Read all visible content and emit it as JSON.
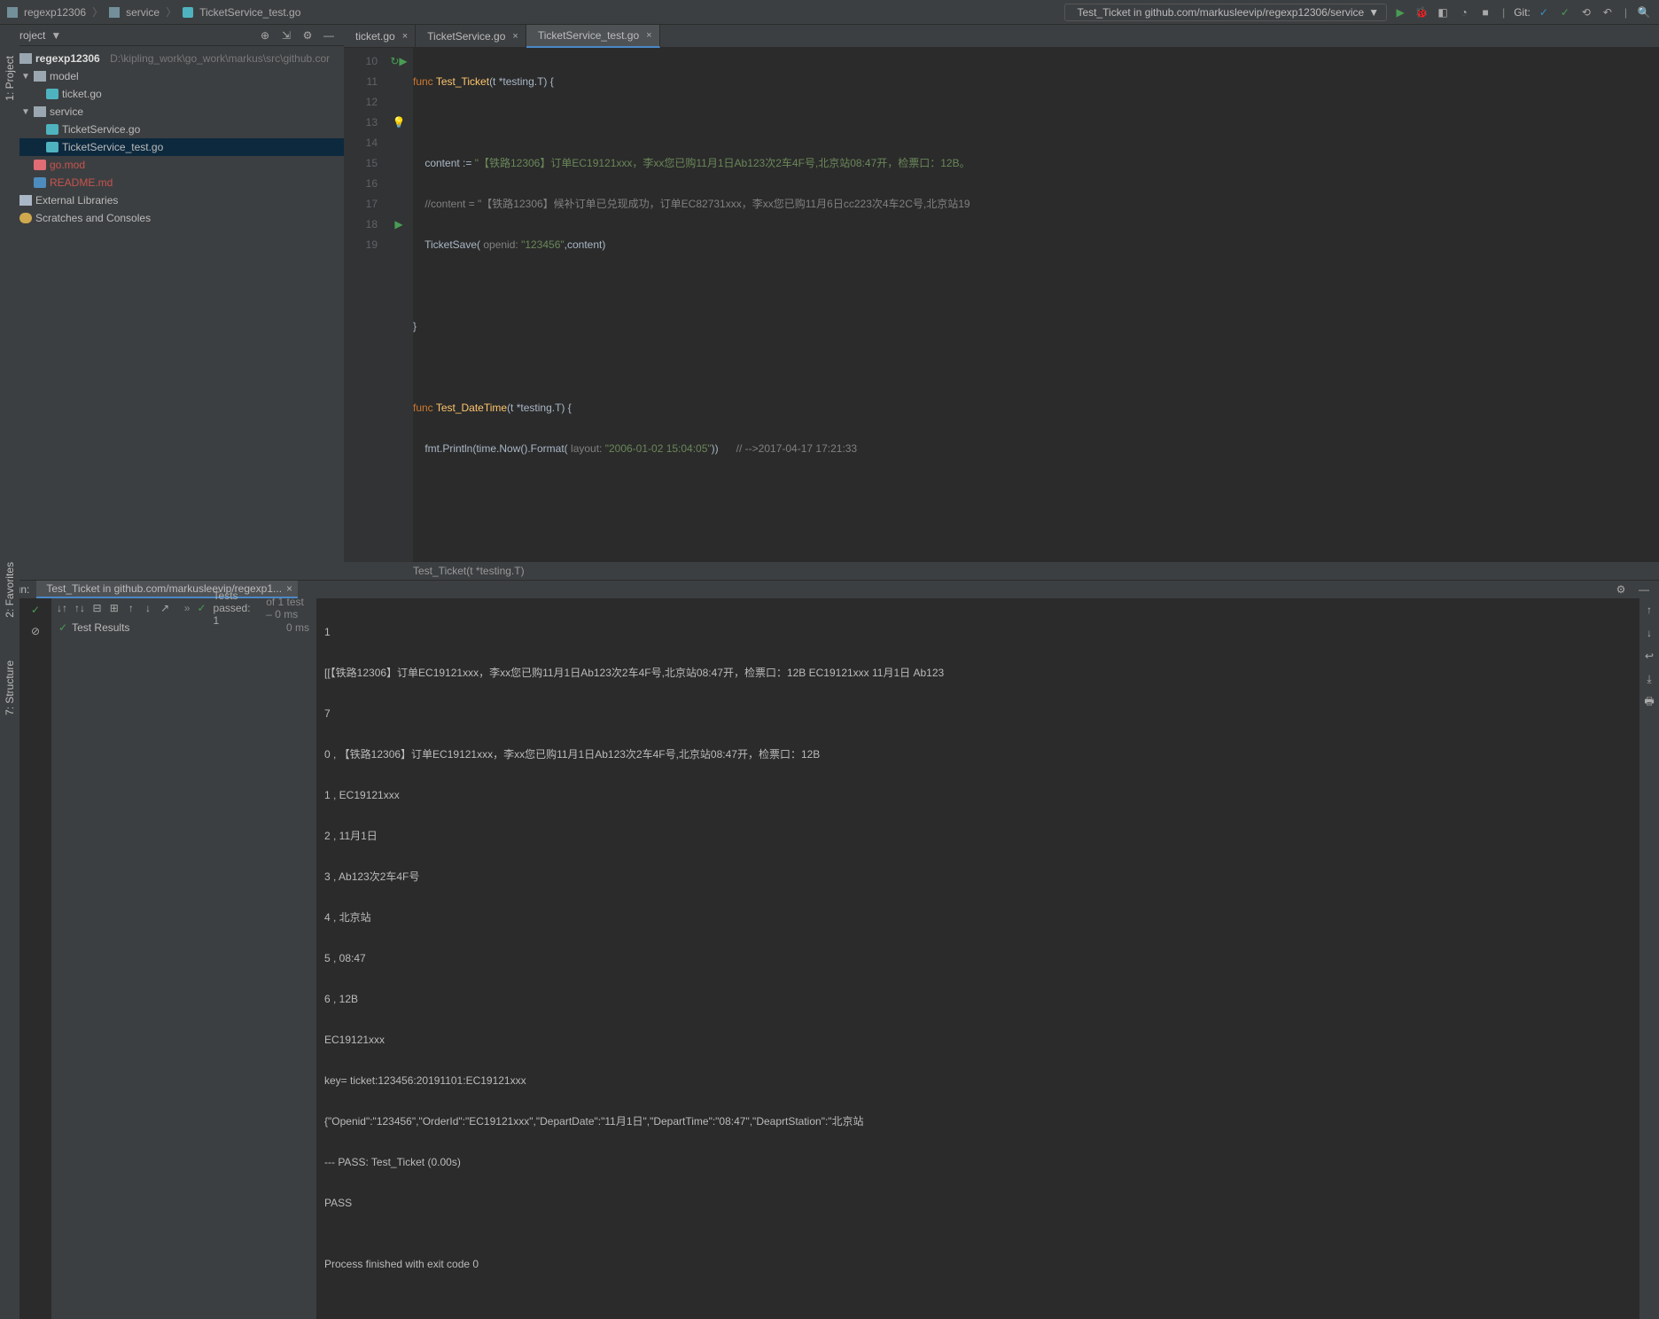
{
  "breadcrumb": {
    "project": "regexp12306",
    "dir": "service",
    "file": "TicketService_test.go"
  },
  "run_config": {
    "label": "Test_Ticket in github.com/markusleevip/regexp12306/service"
  },
  "project_tool": {
    "title": "Project"
  },
  "tree": {
    "root": "regexp12306",
    "root_path": "D:\\kipling_work\\go_work\\markus\\src\\github.cor",
    "model": "model",
    "ticket": "ticket.go",
    "service": "service",
    "svc1": "TicketService.go",
    "svc2": "TicketService_test.go",
    "gomod": "go.mod",
    "readme": "README.md",
    "ext": "External Libraries",
    "scratch": "Scratches and Consoles"
  },
  "tabs": {
    "t1": "ticket.go",
    "t2": "TicketService.go",
    "t3": "TicketService_test.go"
  },
  "code": {
    "lines": [
      "10",
      "11",
      "12",
      "13",
      "14",
      "15",
      "16",
      "17",
      "18",
      "19"
    ],
    "l10a": "func ",
    "l10b": "Test_Ticket",
    "l10c": "(t *testing.T) {",
    "l12a": "    content := ",
    "l12b": "\"【铁路12306】订单EC19121xxx，李xx您已购11月1日Ab123次2车4F号,北京站08:47开，检票口：12B。",
    "l13a": "    //content = \"【铁路12306】候补订单已兑现成功，订单EC82731xxx，李xx您已购11月6日cc223次4车2C号,北京站19",
    "l14a": "    TicketSave(",
    "l14p": " openid: ",
    "l14b": "\"123456\"",
    "l14c": ",content)",
    "l16": "}",
    "l18a": "func ",
    "l18b": "Test_DateTime",
    "l18c": "(t *testing.T) {",
    "l19a": "    fmt.Println(time.Now().Format(",
    "l19p": " layout: ",
    "l19b": "\"2006-01-02 15:04:05\"",
    "l19c": "))",
    "l19d": "      // -->2017-04-17 17:21:33",
    "crumb": "Test_Ticket(t *testing.T)"
  },
  "run": {
    "title": "Run:",
    "tab": "Test_Ticket in github.com/markusleevip/regexp1...",
    "status": "Tests passed: 1",
    "status2": " of 1 test – 0 ms",
    "result": "Test Results",
    "t0": "0 ms"
  },
  "console": {
    "l1": "1",
    "l2": "[[【铁路12306】订单EC19121xxx，李xx您已购11月1日Ab123次2车4F号,北京站08:47开，检票口：12B EC19121xxx 11月1日 Ab123",
    "l3": "7",
    "l4": "0 , 【铁路12306】订单EC19121xxx，李xx您已购11月1日Ab123次2车4F号,北京站08:47开，检票口：12B",
    "l5": "1 , EC19121xxx",
    "l6": "2 , 11月1日",
    "l7": "3 , Ab123次2车4F号",
    "l8": "4 , 北京站",
    "l9": "5 , 08:47",
    "l10": "6 , 12B",
    "l11": "EC19121xxx",
    "l12": "key= ticket:123456:20191101:EC19121xxx",
    "l13": "{\"Openid\":\"123456\",\"OrderId\":\"EC19121xxx\",\"DepartDate\":\"11月1日\",\"DepartTime\":\"08:47\",\"DeaprtStation\":\"北京站",
    "l14": "--- PASS: Test_Ticket (0.00s)",
    "l15": "PASS",
    "l16": "",
    "l17": "Process finished with exit code 0"
  },
  "sidebars": {
    "proj": "1: Project",
    "fav": "2: Favorites",
    "str": "7: Structure"
  },
  "git": "Git:"
}
